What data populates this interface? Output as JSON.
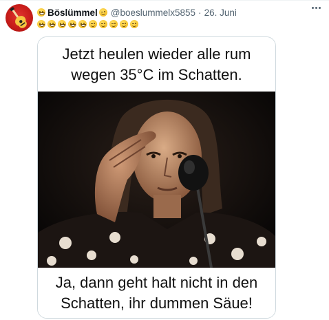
{
  "tweet": {
    "display_name": "Böslümmel",
    "handle": "@boeslummelx5855",
    "separator": "·",
    "date": "26. Juni",
    "name_emoji_left": "grinning-emoji",
    "name_emoji_right": "winking-emoji",
    "text_emojis": [
      "grinning",
      "grinning",
      "grinning",
      "grinning",
      "grinning",
      "winking",
      "winking",
      "winking",
      "winking",
      "winking"
    ],
    "more_icon": "more-horizontal-icon"
  },
  "media": {
    "top_line_1": "Jetzt heulen wieder alle rum",
    "top_line_2": "wegen 35°C im Schatten.",
    "bottom_line_1": "Ja, dann geht halt nicht in den",
    "bottom_line_2": "Schatten, ihr dummen Säue!",
    "photo": "photo-man-holding-forehead-at-microphone"
  },
  "colors": {
    "text": "#0f1419",
    "muted": "#536471",
    "border": "#cfd9de",
    "avatar_red": "#c81d1a"
  }
}
